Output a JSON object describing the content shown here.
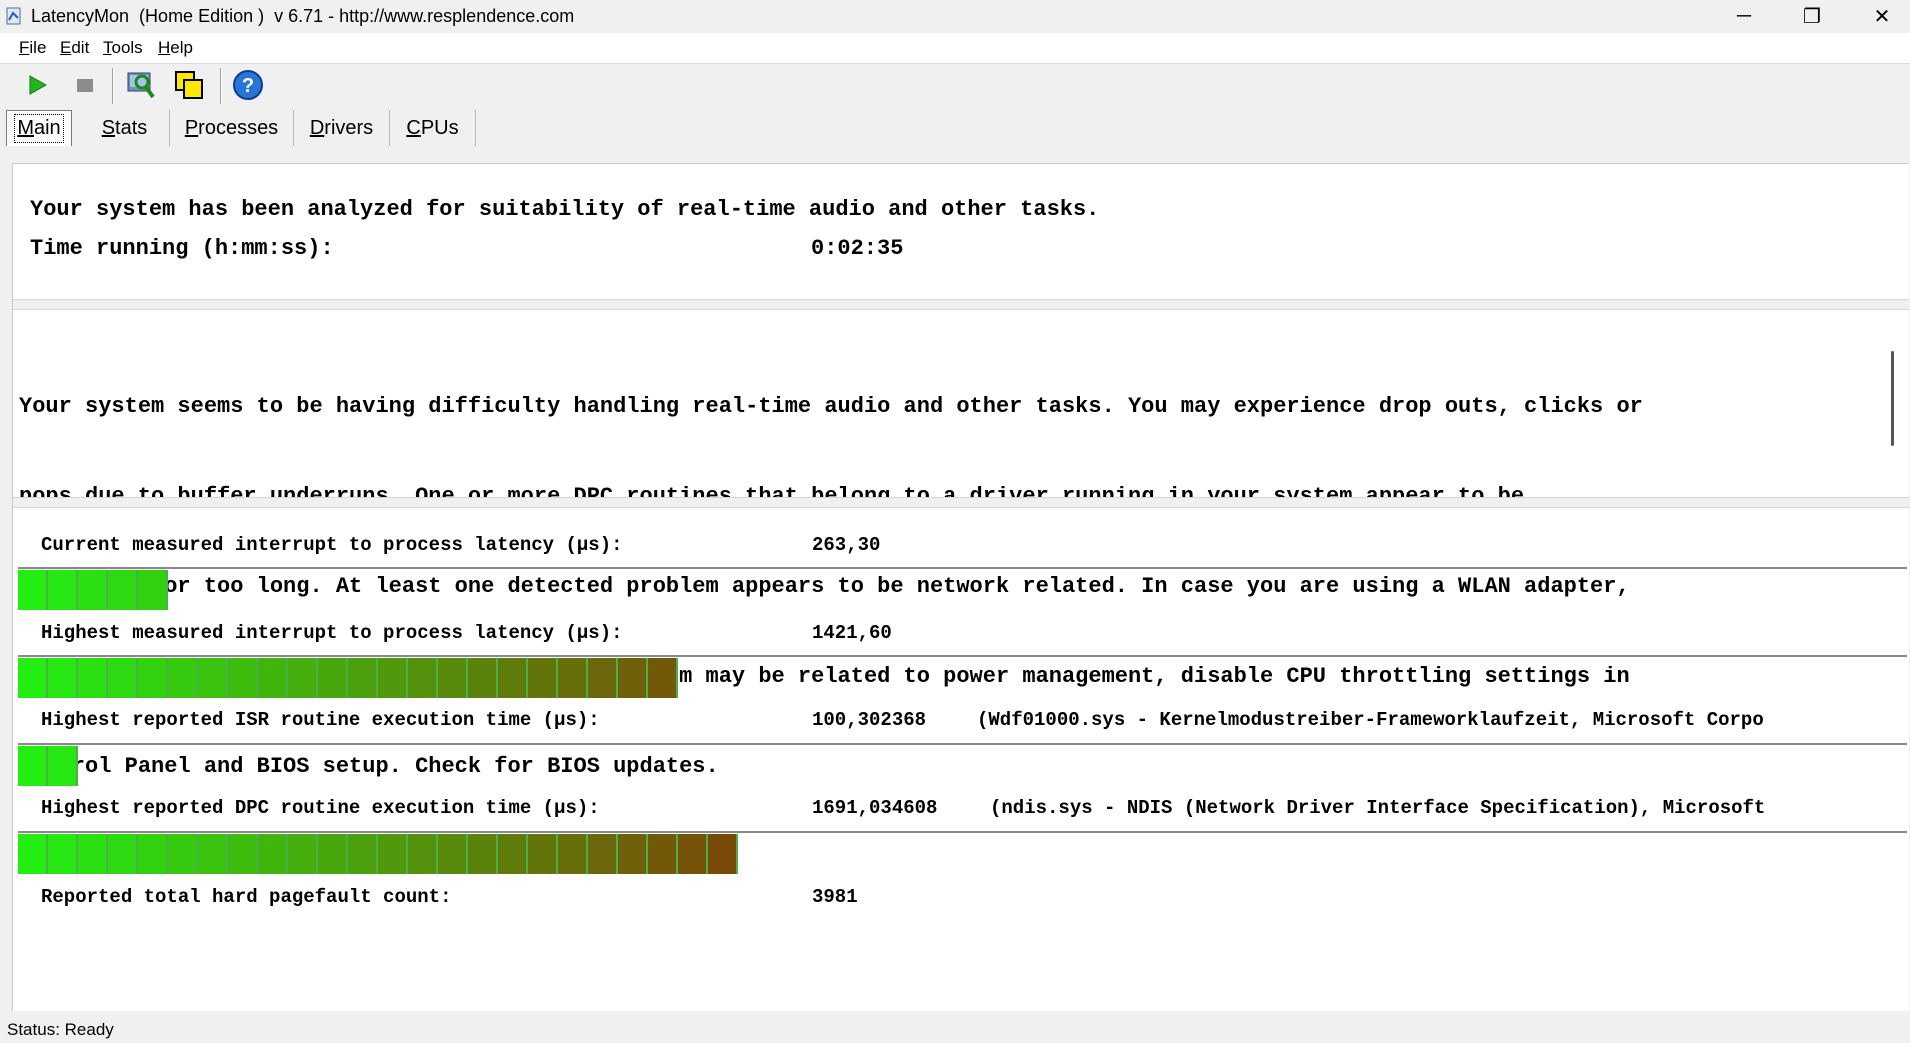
{
  "window": {
    "title": "LatencyMon  (Home Edition )  v 6.71 - http://www.resplendence.com",
    "controls": {
      "minimize": "─",
      "restore": "❐",
      "close": "✕"
    }
  },
  "menu": {
    "file": {
      "key": "F",
      "rest": "ile"
    },
    "edit": {
      "key": "E",
      "rest": "dit"
    },
    "tools": {
      "key": "T",
      "rest": "ools"
    },
    "help": {
      "key": "H",
      "rest": "elp"
    }
  },
  "toolbar": {
    "icons": [
      "play-icon",
      "stop-icon",
      "search-icon",
      "windows-icon",
      "help-icon"
    ],
    "help_glyph": "?"
  },
  "tabs": [
    {
      "key": "M",
      "rest": "ain"
    },
    {
      "key": "S",
      "rest": "tats"
    },
    {
      "key": "P",
      "rest": "rocesses"
    },
    {
      "key": "D",
      "rest": "rivers"
    },
    {
      "key": "C",
      "rest": "PUs"
    }
  ],
  "summary": {
    "analyzed": "Your system has been analyzed for suitability of real-time audio and other tasks.",
    "time_label": "Time running (h:mm:ss):",
    "time_value": "0:02:35"
  },
  "conclusion": {
    "lines": [
      "Your system seems to be having difficulty handling real-time audio and other tasks. You may experience drop outs, clicks or",
      "pops due to buffer underruns. One or more DPC routines that belong to a driver running in your system appear to be",
      "executing for too long. At least one detected problem appears to be network related. In case you are using a WLAN adapter,",
      "try disabling it to get better results. One problem may be related to power management, disable CPU throttling settings in",
      "Control Panel and BIOS setup. Check for BIOS updates."
    ]
  },
  "measurements": [
    {
      "label": "Current measured interrupt to process latency (µs):",
      "value": "263,30",
      "detail": "",
      "bar_segments": 5
    },
    {
      "label": "Highest measured interrupt to process latency (µs):",
      "value": "1421,60",
      "detail": "",
      "bar_segments": 22
    },
    {
      "label": "Highest reported ISR routine execution time (µs):",
      "value": "100,302368",
      "detail": "(Wdf01000.sys - Kernelmodustreiber-Frameworklaufzeit, Microsoft Corpo",
      "bar_segments": 2
    },
    {
      "label": "Highest reported DPC routine execution time (µs):",
      "value": "1691,034608",
      "detail": "(ndis.sys - NDIS (Network Driver Interface Specification), Microsoft",
      "bar_segments": 24
    }
  ],
  "pagefault": {
    "label": "Reported total hard pagefault count:",
    "value": "3981"
  },
  "status": {
    "text": "Status: Ready"
  },
  "colors": {
    "bar_start": "#22ee11",
    "bar_end": "#7a4a08"
  }
}
